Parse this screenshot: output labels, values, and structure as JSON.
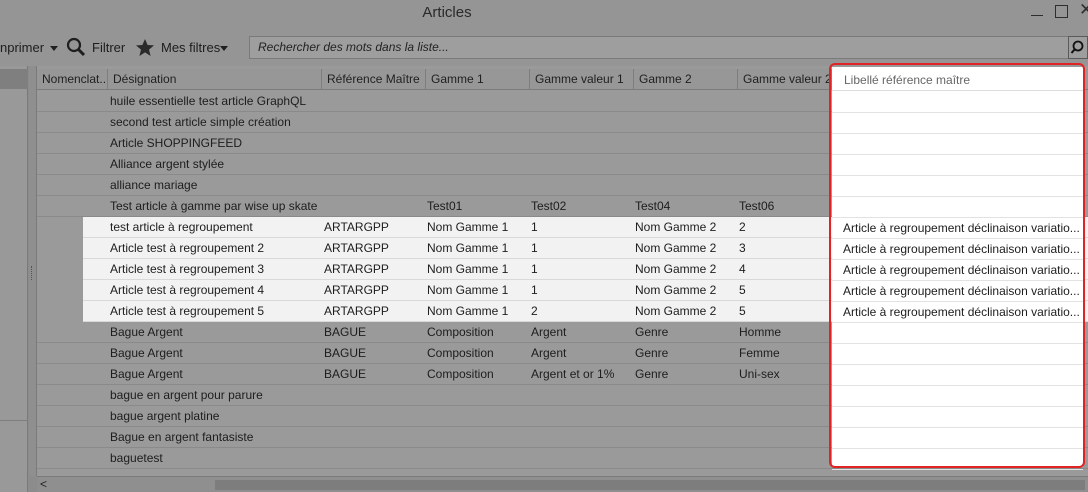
{
  "window": {
    "title": "Articles"
  },
  "toolbar": {
    "print_label": "nprimer",
    "filter_label": "Filtrer",
    "my_filters_label": "Mes filtres",
    "search_placeholder": "Rechercher des mots dans la liste..."
  },
  "columns": [
    "Nomenclat...",
    "Désignation",
    "Référence Maître",
    "Gamme 1",
    "Gamme valeur 1",
    "Gamme 2",
    "Gamme valeur 2",
    "Libellé référence maître"
  ],
  "rows": [
    [
      "",
      "huile essentielle test article GraphQL",
      "",
      "",
      "",
      "",
      "",
      ""
    ],
    [
      "",
      "second test article simple création",
      "",
      "",
      "",
      "",
      "",
      ""
    ],
    [
      "",
      "Article SHOPPINGFEED",
      "",
      "",
      "",
      "",
      "",
      ""
    ],
    [
      "",
      "Alliance argent stylée",
      "",
      "",
      "",
      "",
      "",
      ""
    ],
    [
      "",
      "alliance mariage",
      "",
      "",
      "",
      "",
      "",
      ""
    ],
    [
      "",
      "Test article  à gamme par wise up skate",
      "",
      "Test01",
      "Test02",
      "Test04",
      "Test06",
      ""
    ],
    [
      "",
      "test article à regroupement",
      "ARTARGPP",
      "Nom Gamme 1",
      "1",
      "Nom Gamme 2",
      "2",
      "Article à regroupement déclinaison variatio..."
    ],
    [
      "",
      "Article  test  à regroupement 2",
      "ARTARGPP",
      "Nom Gamme 1",
      "1",
      "Nom Gamme 2",
      "3",
      "Article à regroupement déclinaison variatio..."
    ],
    [
      "",
      "Article test  à regroupement 3",
      "ARTARGPP",
      "Nom Gamme 1",
      "1",
      "Nom Gamme 2",
      "4",
      "Article à regroupement déclinaison variatio..."
    ],
    [
      "",
      "Article test à regroupement 4",
      "ARTARGPP",
      "Nom Gamme 1",
      "1",
      "Nom Gamme 2",
      "5",
      "Article à regroupement déclinaison variatio..."
    ],
    [
      "",
      "Article test à regroupement 5",
      "ARTARGPP",
      "Nom Gamme 1",
      "2",
      "Nom Gamme 2",
      "5",
      "Article à regroupement déclinaison variatio..."
    ],
    [
      "",
      "Bague Argent",
      "BAGUE",
      "Composition",
      "Argent",
      "Genre",
      "Homme",
      ""
    ],
    [
      "",
      "Bague Argent",
      "BAGUE",
      "Composition",
      "Argent",
      "Genre",
      "Femme",
      ""
    ],
    [
      "",
      "Bague Argent",
      "BAGUE",
      "Composition",
      "Argent et or 1%",
      "Genre",
      "Uni-sex",
      ""
    ],
    [
      "",
      "bague en argent pour parure",
      "",
      "",
      "",
      "",
      "",
      ""
    ],
    [
      "",
      "bague argent platine",
      "",
      "",
      "",
      "",
      "",
      ""
    ],
    [
      "",
      "Bague en argent  fantasiste",
      "",
      "",
      "",
      "",
      "",
      ""
    ],
    [
      "",
      "baguetest",
      "",
      "",
      "",
      "",
      "",
      ""
    ]
  ],
  "highlighted_rows": [
    6,
    7,
    8,
    9,
    10
  ],
  "colors": {
    "highlight_border": "#e02424",
    "dim_overlay": "#959595",
    "row_highlight": "#f2f2f2"
  }
}
